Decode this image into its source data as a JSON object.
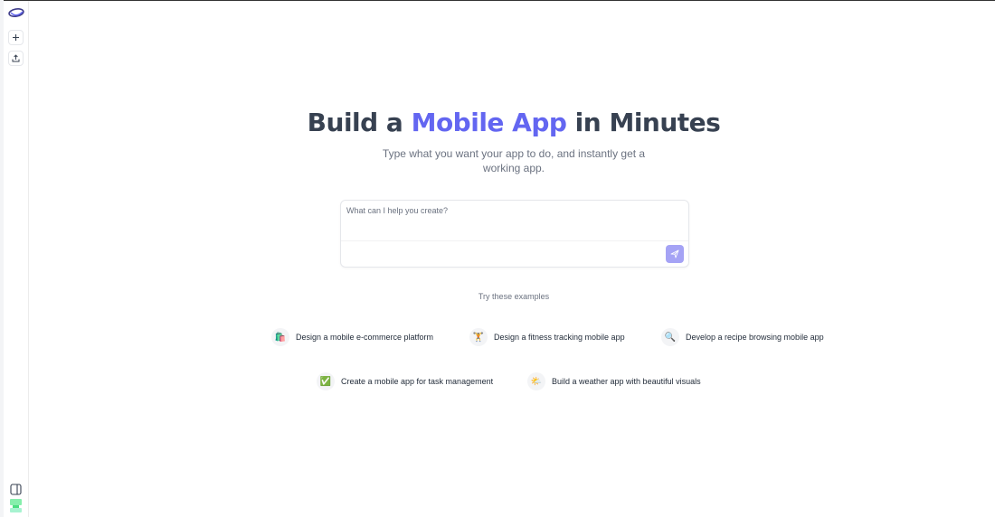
{
  "sidebar": {
    "logo_icon": "app-logo-icon",
    "new_icon": "plus-icon",
    "upload_icon": "upload-icon",
    "panel_icon": "sidebar-toggle-icon",
    "user_icon": "user-avatar-icon"
  },
  "hero": {
    "title_prefix": "Build a ",
    "title_accent": "Mobile App",
    "title_suffix": " in Minutes",
    "subtitle": "Type what you want your app to do, and instantly get a working app."
  },
  "prompt": {
    "placeholder": "What can I help you create?",
    "value": "",
    "send_icon": "send-icon"
  },
  "examples": {
    "label": "Try these examples",
    "items": [
      {
        "emoji": "🛍️",
        "label": "Design a mobile e-commerce platform"
      },
      {
        "emoji": "🏋️",
        "label": "Design a fitness tracking mobile app"
      },
      {
        "emoji": "🔍",
        "label": "Develop a recipe browsing mobile app"
      },
      {
        "emoji": "✅",
        "label": "Create a mobile app for task management"
      },
      {
        "emoji": "🌤️",
        "label": "Build a weather app with beautiful visuals"
      }
    ]
  },
  "colors": {
    "accent": "#6366f1",
    "send_button": "#a5a3f5",
    "title": "#374151",
    "muted": "#6b7280"
  }
}
